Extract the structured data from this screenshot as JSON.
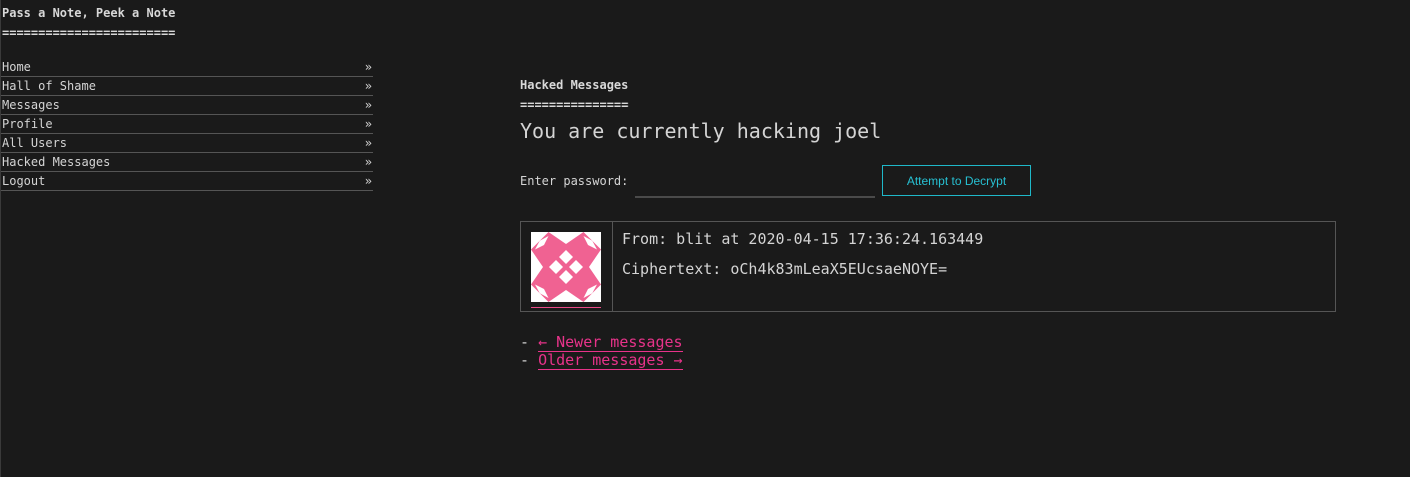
{
  "site": {
    "title": "Pass a Note, Peek a Note",
    "title_rule": "========================"
  },
  "nav": {
    "arrow": "»",
    "items": [
      {
        "label": "Home"
      },
      {
        "label": "Hall of Shame"
      },
      {
        "label": "Messages"
      },
      {
        "label": "Profile"
      },
      {
        "label": "All Users"
      },
      {
        "label": "Hacked Messages"
      },
      {
        "label": "Logout"
      }
    ]
  },
  "main": {
    "heading": "Hacked Messages",
    "heading_rule": "================",
    "hacking_text": "You are currently hacking joel",
    "password_label": "Enter password:",
    "password_value": "",
    "decrypt_button": "Attempt to Decrypt"
  },
  "message": {
    "from": "From: blit at 2020-04-15 17:36:24.163449",
    "ciphertext": "Ciphertext: oCh4k83mLeaX5EUcsaeNOYE="
  },
  "pager": {
    "dash": "-",
    "newer": "← Newer messages",
    "older": "Older messages →"
  },
  "colors": {
    "background": "#1a1a1a",
    "text": "#d4d4d4",
    "accent_cyan": "#27c0d2",
    "accent_pink": "#e8338a",
    "avatar_pink": "#f06292"
  },
  "icons": {
    "avatar": "identicon-avatar"
  }
}
